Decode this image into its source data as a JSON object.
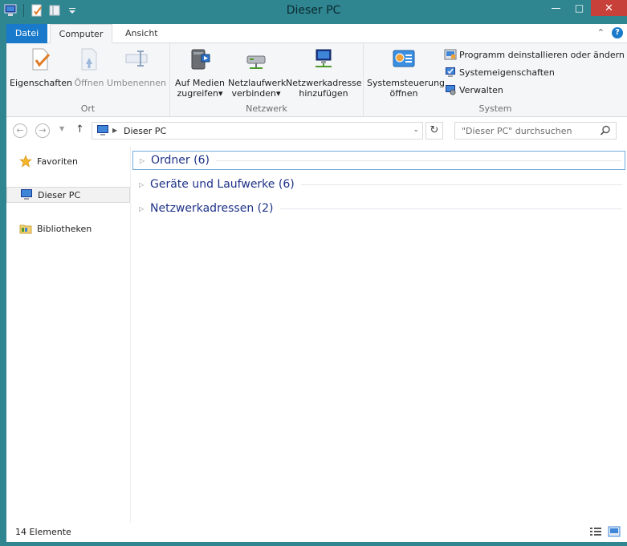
{
  "window": {
    "title": "Dieser PC"
  },
  "ribbon_tabs": {
    "file": "Datei",
    "computer": "Computer",
    "view": "Ansicht"
  },
  "ribbon": {
    "groups": {
      "location": "Ort",
      "network": "Netzwerk",
      "system": "System"
    },
    "properties": "Eigenschaften",
    "open": "Öffnen",
    "rename": "Umbenennen",
    "access_media_l1": "Auf Medien",
    "access_media_l2": "zugreifen",
    "map_drive_l1": "Netzlaufwerk",
    "map_drive_l2": "verbinden",
    "add_network_l1": "Netzwerkadresse",
    "add_network_l2": "hinzufügen",
    "control_panel_l1": "Systemsteuerung",
    "control_panel_l2": "öffnen",
    "uninstall": "Programm deinstallieren oder ändern",
    "system_props": "Systemeigenschaften",
    "manage": "Verwalten"
  },
  "address": {
    "path": "Dieser PC",
    "search_placeholder": "\"Dieser PC\" durchsuchen"
  },
  "navpane": {
    "favorites": "Favoriten",
    "this_pc": "Dieser PC",
    "libraries": "Bibliotheken"
  },
  "groups": [
    {
      "label": "Ordner (6)"
    },
    {
      "label": "Geräte und Laufwerke (6)"
    },
    {
      "label": "Netzwerkadressen (2)"
    }
  ],
  "status": {
    "items": "14 Elemente"
  },
  "colors": {
    "frame": "#2f8590",
    "file_tab": "#1979ca",
    "group_header": "#1e3287",
    "close_button": "#c7413a"
  }
}
